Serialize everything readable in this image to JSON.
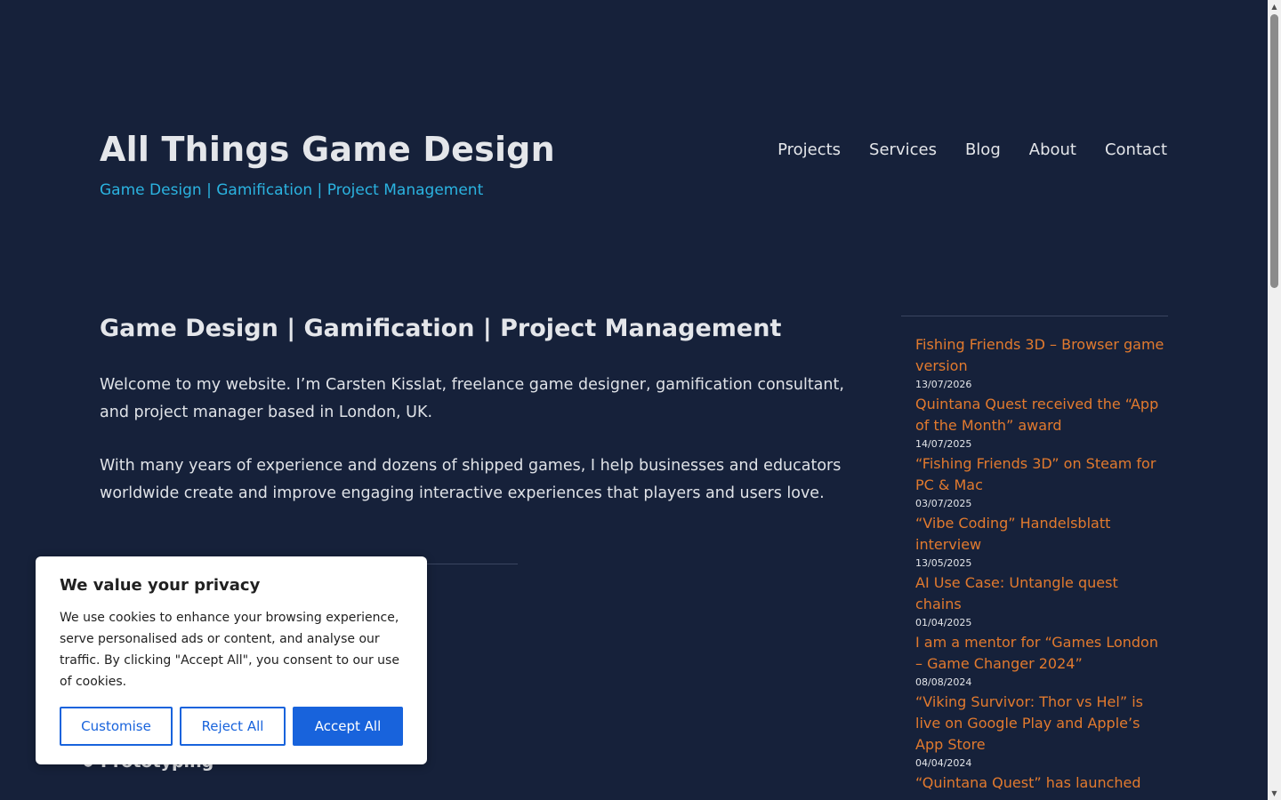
{
  "header": {
    "site_title": "All Things Game Design",
    "tagline": "Game Design | Gamification | Project Management",
    "nav": [
      {
        "label": "Projects"
      },
      {
        "label": "Services"
      },
      {
        "label": "Blog"
      },
      {
        "label": "About"
      },
      {
        "label": "Contact"
      }
    ]
  },
  "main": {
    "heading": "Game Design | Gamification | Project Management",
    "paragraphs": [
      "Welcome to my website. I’m Carsten Kisslat, freelance game designer, gamification consultant, and project manager based in London, UK.",
      "With many years of experience and dozens of shipped games, I help businesses and educators worldwide create and improve engaging interactive experiences that players and users love."
    ],
    "services": [
      {
        "label": "Prototyping"
      }
    ]
  },
  "sidebar": {
    "recent_posts": [
      {
        "title": "Fishing Friends 3D – Browser game version",
        "date": "13/07/2026"
      },
      {
        "title": "Quintana Quest received the “App of the Month” award",
        "date": "14/07/2025"
      },
      {
        "title": "“Fishing Friends 3D” on Steam for PC & Mac",
        "date": "03/07/2025"
      },
      {
        "title": "“Vibe Coding” Handelsblatt interview",
        "date": "13/05/2025"
      },
      {
        "title": "AI Use Case: Untangle quest chains",
        "date": "01/04/2025"
      },
      {
        "title": "I am a mentor for “Games London – Game Changer 2024”",
        "date": "08/08/2024"
      },
      {
        "title": "“Viking Survivor: Thor vs Hel” is live on Google Play and Apple’s App Store",
        "date": "04/04/2024"
      },
      {
        "title": "“Quintana Quest” has launched",
        "date": ""
      }
    ]
  },
  "cookie_banner": {
    "title": "We value your privacy",
    "text": "We use cookies to enhance your browsing experience, serve personalised ads or content, and analyse our traffic. By clicking \"Accept All\", you consent to our use of cookies.",
    "customise_label": "Customise",
    "reject_label": "Reject All",
    "accept_label": "Accept All"
  },
  "colors": {
    "background": "#16213a",
    "accent_link": "#e27a2e",
    "tagline": "#2bb3e0",
    "button_primary": "#1863dc"
  },
  "icons": {
    "scroll_up": "triangle-up-icon",
    "scroll_down": "triangle-down-icon",
    "list_bullet": "bullet-icon"
  }
}
